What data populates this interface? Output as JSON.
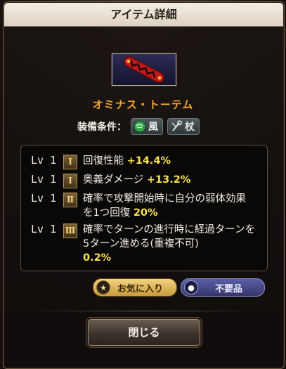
{
  "dialog": {
    "title": "アイテム詳細"
  },
  "item": {
    "name": "オミナス・トーテム"
  },
  "equip": {
    "label": "装備条件：",
    "element": "風",
    "weapon": "杖",
    "element_icon": "wind-icon",
    "weapon_icon": "staff-icon"
  },
  "skills": [
    {
      "lv": "Lv 1",
      "tier": "Ⅰ",
      "desc": "回復性能",
      "value": "+14.4%"
    },
    {
      "lv": "Lv 1",
      "tier": "Ⅰ",
      "desc": "奥義ダメージ",
      "value": "+13.2%"
    },
    {
      "lv": "Lv 1",
      "tier": "Ⅱ",
      "desc": "確率で攻撃開始時に自分の弱体効果を1つ回復",
      "value": "20%"
    },
    {
      "lv": "Lv 1",
      "tier": "Ⅲ",
      "desc": "確率でターンの進行時に経過ターンを5ターン進める(重複不可)",
      "value": "0.2%"
    }
  ],
  "buttons": {
    "favorite": "お気に入り",
    "unneeded": "不要品",
    "close": "閉じる"
  },
  "colors": {
    "item_name": "#f0a72a",
    "value": "#f6e24c",
    "favorite_bg": "#e4bc5e",
    "unneeded_bg": "#474b8a"
  }
}
